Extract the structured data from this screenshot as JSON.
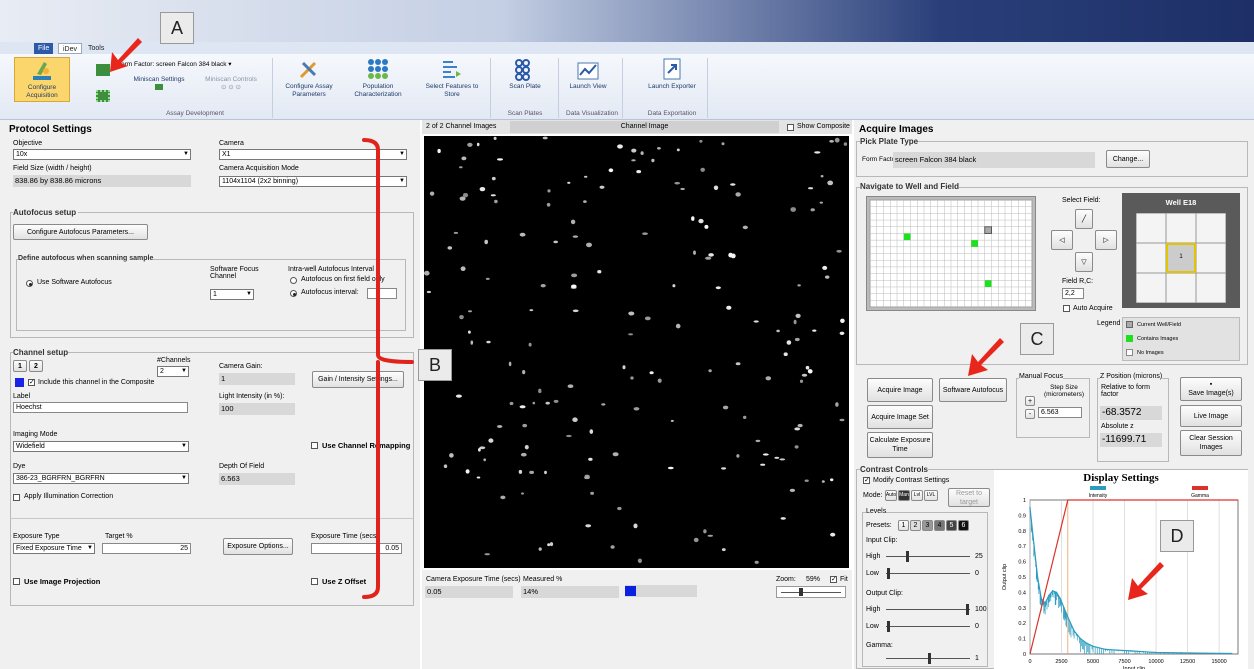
{
  "ribbon": {
    "tabs": [
      "File",
      "iDev",
      "Tools"
    ],
    "form_factor_label": "Form Factor:",
    "form_factor_value": "screen Falcon 384 black",
    "buttons": {
      "configure_acquisition": "Configure Acquisition",
      "miniscan_settings": "Miniscan Settings",
      "miniscan_controls": "Miniscan Controls",
      "configure_assay": "Configure Assay Parameters",
      "population": "Population Characterization",
      "select_features": "Select Features to Store",
      "scan_plate": "Scan Plate",
      "launch_view": "Launch View",
      "launch_exporter": "Launch Exporter"
    },
    "groups": {
      "assay_development": "Assay Development",
      "scan_plates": "Scan Plates",
      "data_visualization": "Data Visualization",
      "data_exportation": "Data Exportation"
    }
  },
  "protocol": {
    "title": "Protocol Settings",
    "objective_label": "Objective",
    "objective_value": "10x",
    "camera_label": "Camera",
    "camera_value": "X1",
    "field_size_label": "Field Size (width / height)",
    "field_size_value": "838.86 by 838.86 microns",
    "acq_mode_label": "Camera Acquisition Mode",
    "acq_mode_value": "1104x1104 (2x2 binning)",
    "autofocus_setup": "Autofocus setup",
    "configure_autofocus": "Configure Autofocus Parameters...",
    "define_autofocus": "Define autofocus when scanning sample",
    "use_software_af": "Use Software Autofocus",
    "sw_focus_channel_label": "Software Focus Channel",
    "sw_focus_channel_value": "1",
    "intra_well_label": "Intra-well Autofocus Interval",
    "af_first_field": "Autofocus on first field only",
    "af_interval": "Autofocus interval:",
    "channel_setup": "Channel setup",
    "channel_tabs": [
      "1",
      "2"
    ],
    "nchannels_label": "#Channels",
    "nchannels_value": "2",
    "camera_gain_label": "Camera Gain:",
    "camera_gain_value": "1",
    "gain_intensity_btn": "Gain / Intensity Settings...",
    "include_composite": "Include this channel in the Composite",
    "label_label": "Label",
    "label_value": "Hoechst",
    "light_intensity_label": "Light Intensity (in %):",
    "light_intensity_value": "100",
    "imaging_mode_label": "Imaging Mode",
    "imaging_mode_value": "Widefield",
    "use_channel_remapping": "Use Channel Remapping",
    "dye_label": "Dye",
    "dye_value": "386-23_BGRFRN_BGRFRN",
    "dof_label": "Depth Of Field",
    "dof_value": "6.563",
    "apply_illumination": "Apply Illumination Correction",
    "exposure_type_label": "Exposure Type",
    "exposure_type_value": "Fixed Exposure Time",
    "target_label": "Target %",
    "target_value": "25",
    "exposure_options_btn": "Exposure Options...",
    "exposure_time_label": "Exposure Time (secs)",
    "exposure_time_value": "0.05",
    "use_image_projection": "Use Image Projection",
    "use_z_offset": "Use Z Offset"
  },
  "viewer": {
    "channel_count": "2 of 2 Channel Images",
    "channel_image": "Channel Image",
    "show_composite": "Show Composite",
    "exposure_label": "Camera Exposure Time (secs)",
    "exposure_value": "0.05",
    "measured_label": "Measured %",
    "measured_value": "14%",
    "measured_fraction": 0.14,
    "zoom_label": "Zoom:",
    "zoom_value": "59%",
    "fit_label": "Fit"
  },
  "acquire": {
    "title": "Acquire Images",
    "pick_plate": "Pick Plate Type",
    "form_factor_label": "Form Factor",
    "form_factor_value": "screen Falcon 384 black",
    "change_btn": "Change...",
    "navigate": "Navigate to Well and Field",
    "select_field": "Select Field:",
    "well_label": "Well E18",
    "well_center": "1",
    "field_rc_label": "Field R,C:",
    "field_rc_value": "2,2",
    "auto_acquire": "Auto Acquire",
    "legend_label": "Legend",
    "legend_items": [
      "Current Well/Field",
      "Contains Images",
      "No Images"
    ],
    "acquire_image": "Acquire Image",
    "software_autofocus": "Software Autofocus",
    "acquire_image_set": "Acquire Image Set",
    "calculate_exposure": "Calculate Exposure Time",
    "manual_focus": "Manual Focus",
    "step_size_label": "Step Size (micrometers)",
    "step_size_value": "6.563",
    "z_position": "Z Position (microns)",
    "relative_label": "Relative to form factor",
    "relative_value": "-68.3572",
    "absolute_label": "Absolute z",
    "absolute_value": "-11699.71",
    "save_images": "Save Image(s)",
    "live_image": "Live Image",
    "clear_session": "Clear Session Images"
  },
  "contrast": {
    "title": "Contrast Controls",
    "modify": "Modify Contrast Settings",
    "mode_label": "Mode:",
    "modes": [
      "Auto",
      "Man",
      "Lvl",
      "LVL"
    ],
    "reset_btn": "Reset to target",
    "levels_label": "Levels",
    "presets_label": "Presets:",
    "presets": [
      "1",
      "2",
      "3",
      "4",
      "5",
      "6"
    ],
    "input_clip": "Input Clip:",
    "high_label": "High",
    "high_value": "25",
    "low_label": "Low",
    "low_value": "0",
    "output_clip": "Output Clip:",
    "out_high_value": "100",
    "out_low_value": "0",
    "gamma_label": "Gamma:",
    "gamma_value": "1"
  },
  "display_settings": {
    "title": "Display Settings",
    "legend_intensity": "Intensity",
    "legend_gamma": "Gamma",
    "ylabel": "Output clip",
    "xlabel": "Input clip",
    "yticks": [
      "1",
      "0.9",
      "0.8",
      "0.7",
      "0.6",
      "0.5",
      "0.4",
      "0.3",
      "0.2",
      "0.1",
      "0"
    ],
    "xticks": [
      "0",
      "2500",
      "5000",
      "7500",
      "10000",
      "12500",
      "15000"
    ]
  },
  "chart_data": {
    "type": "line",
    "title": "Display Settings",
    "xlabel": "Input clip",
    "ylabel": "Output clip",
    "xlim": [
      0,
      16500
    ],
    "ylim": [
      0,
      1
    ],
    "series": [
      {
        "name": "Intensity",
        "x": [
          0,
          300,
          600,
          900,
          1200,
          1500,
          1800,
          2100,
          2400,
          2700,
          3000,
          3500,
          4000,
          4500,
          5000,
          6000,
          7000,
          8000,
          9000,
          10000,
          12000,
          14000,
          16000
        ],
        "y": [
          0.95,
          0.72,
          0.5,
          0.36,
          0.33,
          0.38,
          0.41,
          0.4,
          0.36,
          0.3,
          0.24,
          0.15,
          0.1,
          0.07,
          0.05,
          0.03,
          0.025,
          0.02,
          0.015,
          0.01,
          0.008,
          0.005,
          0.003
        ]
      },
      {
        "name": "Gamma",
        "x": [
          0,
          3000,
          16500
        ],
        "y": [
          0,
          1,
          1
        ]
      }
    ]
  },
  "callouts": [
    "A",
    "B",
    "C",
    "D"
  ],
  "colors": {
    "intensity": "#2a9cbf",
    "gamma": "#d9342b",
    "arrow": "#e8261b",
    "bracket": "#e0241b"
  }
}
